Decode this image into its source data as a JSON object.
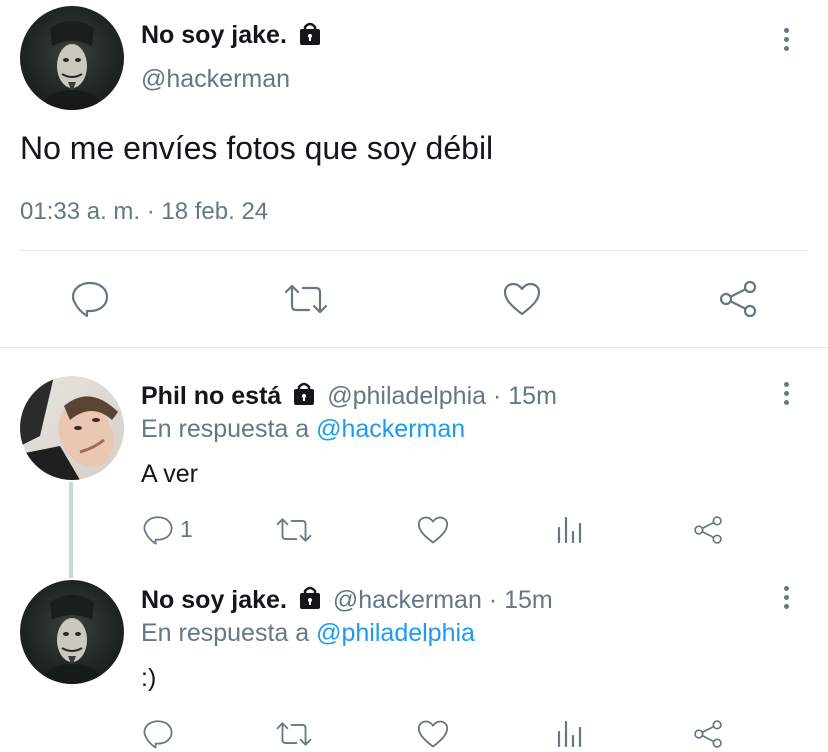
{
  "main_tweet": {
    "author_name": "No soy jake.",
    "handle": "@hackerman",
    "text": "No me envíes fotos que soy débil",
    "timestamp": "01:33 a. m. · 18 feb. 24",
    "actions": [
      "reply-icon",
      "retweet-icon",
      "like-icon",
      "share-icon"
    ]
  },
  "replies": [
    {
      "author_name": "Phil no está",
      "handle": "@philadelphia",
      "time": "· 15m",
      "reply_prefix": "En respuesta a",
      "reply_to": "@hackerman",
      "text": "A ver",
      "reply_count": "1"
    },
    {
      "author_name": "No soy jake.",
      "handle": "@hackerman",
      "time": "· 15m",
      "reply_prefix": "En respuesta a",
      "reply_to": "@philadelphia",
      "text": ":)"
    }
  ],
  "colors": {
    "link": "#1d9bf0",
    "muted": "#657786",
    "divider": "#e1e8ed"
  }
}
